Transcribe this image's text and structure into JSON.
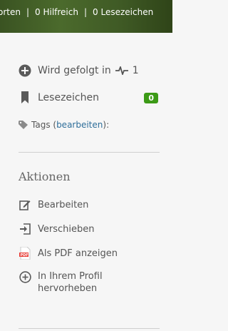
{
  "stats": {
    "answers": "orten",
    "helpful": "0 Hilfreich",
    "bookmarks": "0 Lesezeichen",
    "separator": "|"
  },
  "sidebar": {
    "follow_label": "Wird gefolgt in",
    "follow_count": "1",
    "bookmark_label": "Lesezeichen",
    "bookmark_count": "0",
    "tags_label": "Tags (",
    "tags_edit": "bearbeiten",
    "tags_suffix": "):"
  },
  "actions": {
    "title": "Aktionen",
    "edit": "Bearbeiten",
    "move": "Verschieben",
    "pdf": "Als PDF anzeigen",
    "feature_line1": "In Ihrem Profil",
    "feature_line2": "hervorheben"
  },
  "colors": {
    "banner": "#3f5a25",
    "badge": "#3c9a16",
    "link": "#2e6e9a",
    "pdf": "#e8413a"
  }
}
